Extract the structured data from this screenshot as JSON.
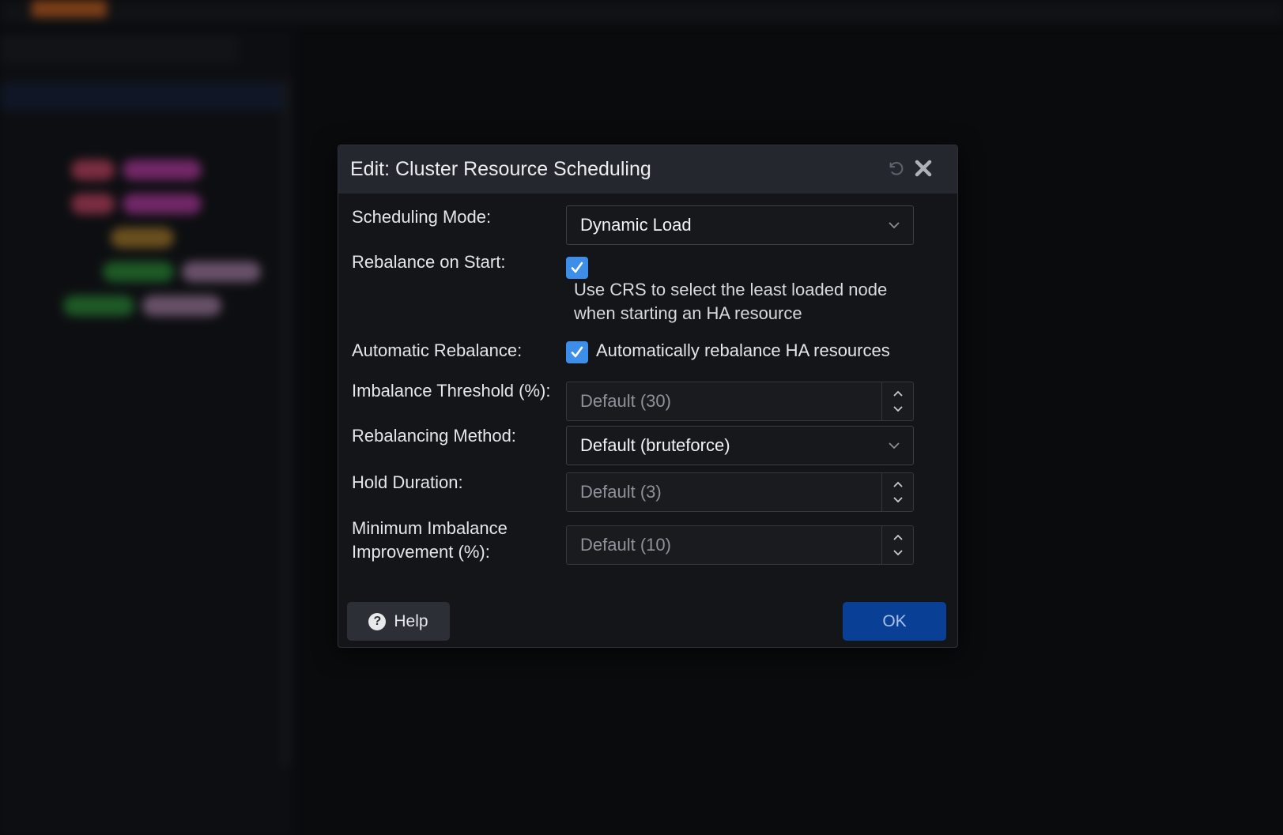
{
  "dialog": {
    "title": "Edit: Cluster Resource Scheduling",
    "header_tools": [
      "undo-icon",
      "close-icon"
    ],
    "fields": {
      "scheduling_mode": {
        "label": "Scheduling Mode:",
        "value": "Dynamic Load"
      },
      "rebalance_on_start": {
        "label": "Rebalance on Start:",
        "checked": true,
        "hint": "Use CRS to select the least loaded node when starting an HA resource"
      },
      "automatic_rebalance": {
        "label": "Automatic Rebalance:",
        "checked": true,
        "box_label": "Automatically rebalance HA resources"
      },
      "imbalance_threshold": {
        "label": "Imbalance Threshold (%):",
        "placeholder": "Default (30)"
      },
      "rebalancing_method": {
        "label": "Rebalancing Method:",
        "value": "Default (bruteforce)"
      },
      "hold_duration": {
        "label": "Hold Duration:",
        "placeholder": "Default (3)"
      },
      "min_imbalance_improvement": {
        "label_line1": "Minimum Imbalance",
        "label_line2": "Improvement (%):",
        "placeholder": "Default (10)"
      }
    },
    "buttons": {
      "help": "Help",
      "ok": "OK"
    }
  },
  "colors": {
    "dialog_bg": "#141519",
    "header_bg": "#24272d",
    "checkbox": "#3d8ee8",
    "ok_button": "#0a3f96"
  }
}
